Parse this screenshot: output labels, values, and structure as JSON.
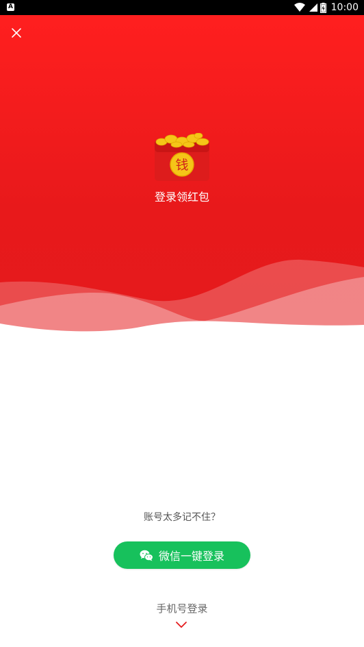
{
  "status_bar": {
    "time": "10:00",
    "notification_icon": "a-icon",
    "wifi_icon": "wifi-icon",
    "signal_icon": "signal-icon",
    "battery_icon": "battery-icon"
  },
  "hero": {
    "close_icon": "close-icon",
    "redpacket_icon": "red-envelope-icon",
    "redpacket_char": "钱",
    "title": "登录领红包",
    "colors": {
      "background": "#e41a1c",
      "coin": "#f5c518"
    }
  },
  "login": {
    "forgot_text": "账号太多记不住？",
    "wechat_button_label": "微信一键登录",
    "wechat_icon": "wechat-icon",
    "wechat_color": "#17c15c",
    "phone_login_label": "手机号登录",
    "expand_icon": "chevron-down-icon"
  }
}
